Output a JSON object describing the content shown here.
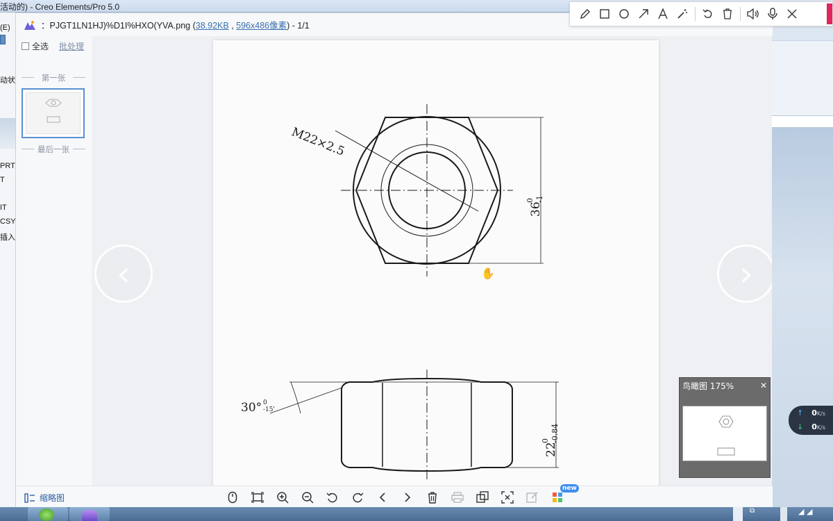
{
  "background_app": {
    "title": "活动的) - Creo Elements/Pro 5.0",
    "left_labels": [
      "(E)",
      "动状",
      "PRT",
      "T",
      "IT",
      "CSYS",
      "插入"
    ]
  },
  "annotation_toolbar": {
    "tools": [
      "pencil-icon",
      "rectangle-icon",
      "circle-icon",
      "arrow-icon",
      "text-icon",
      "magic-wand-icon",
      "undo-icon",
      "delete-icon",
      "speaker-icon",
      "microphone-icon",
      "close-icon"
    ]
  },
  "viewer": {
    "file_prefix": "：PJGT1LN1HJ)%D1I%HXO(YVA.png (",
    "file_size": "38.92KB",
    "sep": " , ",
    "dimensions": "596x486像素",
    "file_suffix": ") - 1/1",
    "select_all": "全选",
    "batch": "批处理",
    "first": "第一张",
    "last": "最后一张",
    "thumbnails_btn": "缩略图",
    "new_badge": "new"
  },
  "drawing": {
    "thread_label": "M22×2.5",
    "height_label": "36",
    "height_tol_upper": "0",
    "height_tol_lower": "-1",
    "width_label": "22",
    "width_tol_upper": "0",
    "width_tol_lower": "-0.84",
    "angle_label": "30°",
    "angle_tol_upper": "0",
    "angle_tol_lower": "-15'"
  },
  "birdview": {
    "title": "鸟瞰图 175%"
  },
  "netspeed": {
    "up": "0",
    "down": "0",
    "unit": "K/s"
  }
}
